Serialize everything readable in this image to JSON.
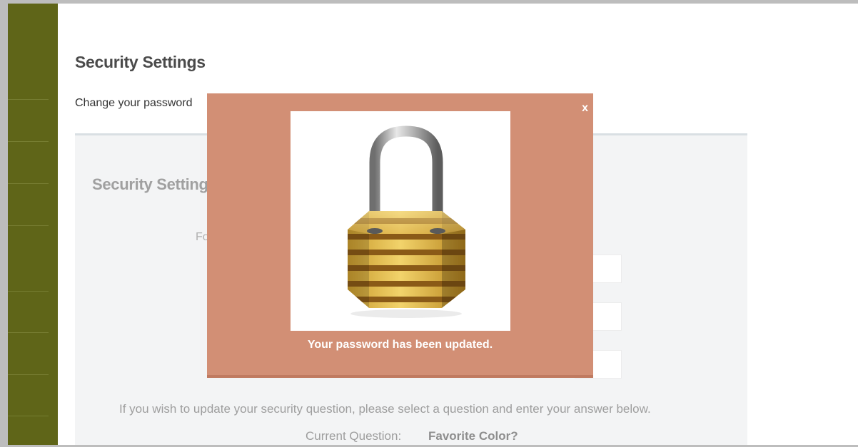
{
  "page": {
    "title": "Security Settings",
    "intro": "Change your password"
  },
  "panel": {
    "title": "Security Settings",
    "form_label": "Fo",
    "security_question_note": "If you wish to update your security question, please select a question and enter your answer below.",
    "current_question_label": "Current Question:",
    "current_question_value": "Favorite Color?"
  },
  "modal": {
    "close_label": "x",
    "image_icon": "padlock-icon",
    "message": "Your password has been updated."
  },
  "colors": {
    "sidebar": "#5f6518",
    "modal_background": "#d28f75",
    "panel_background": "#f3f4f5"
  }
}
